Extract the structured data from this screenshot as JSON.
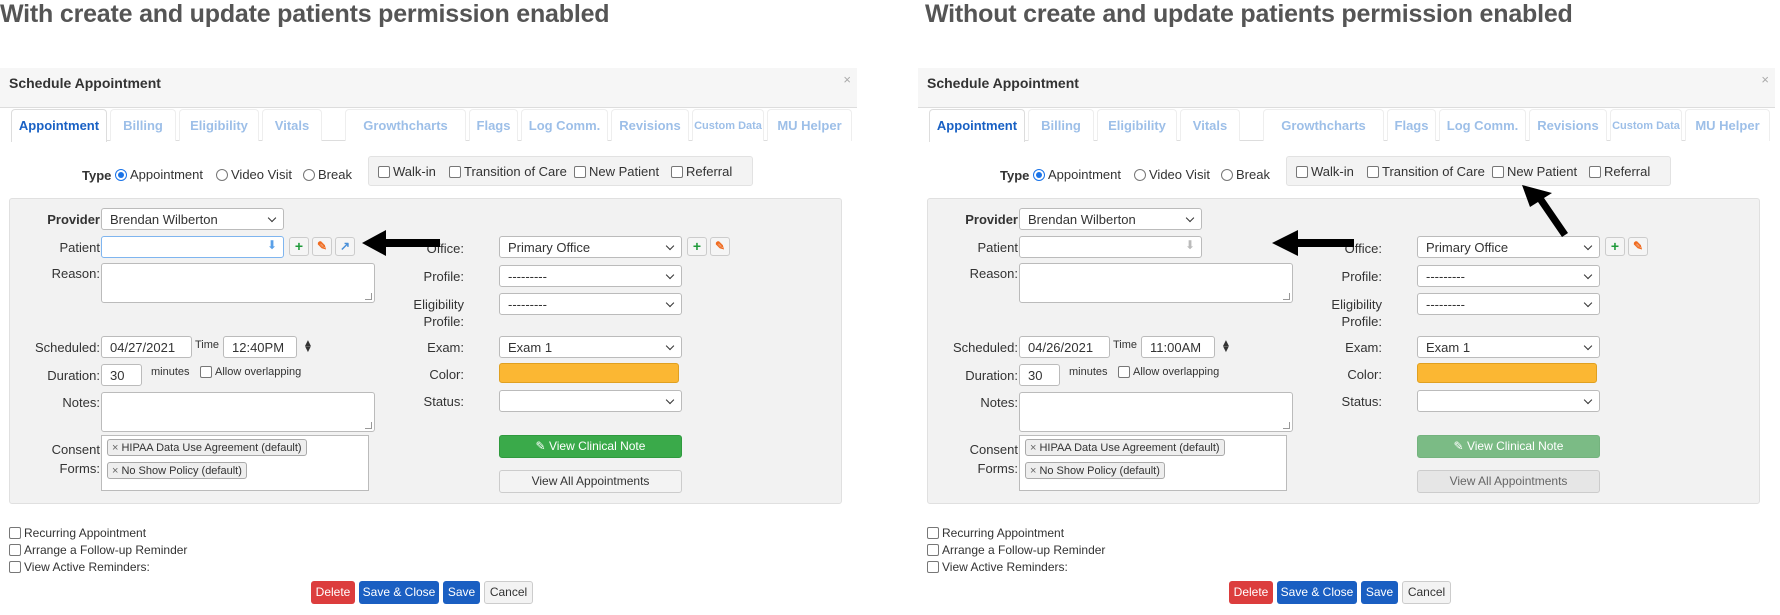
{
  "headings": {
    "left": "With create and update patients permission enabled",
    "right": "Without create and update patients permission enabled"
  },
  "panels": [
    {
      "modal_title": "Schedule Appointment",
      "close_icon": "×",
      "tabs": [
        "Appointment",
        "Billing",
        "Eligibility",
        "Vitals",
        "Growthcharts",
        "Flags",
        "Log Comm.",
        "Revisions",
        "Custom Data",
        "MU Helper"
      ],
      "active_tab": "Appointment",
      "type_label": "Type",
      "type_options": [
        "Appointment",
        "Video Visit",
        "Break"
      ],
      "type_selected": "Appointment",
      "flags": [
        "Walk-in",
        "Transition of Care",
        "New Patient",
        "Referral"
      ],
      "provider_label": "Provider",
      "provider_value": "Brendan Wilberton",
      "patient_label": "Patient",
      "patient_value": "",
      "patient_editable": true,
      "reason_label": "Reason:",
      "scheduled_label": "Scheduled:",
      "scheduled_date": "04/27/2021",
      "time_label": "Time",
      "time_value": "12:40PM",
      "duration_label": "Duration:",
      "duration_value": "30",
      "minutes_label": "minutes",
      "allow_overlapping": "Allow overlapping",
      "notes_label": "Notes:",
      "consent_label_1": "Consent",
      "consent_label_2": "Forms:",
      "consent_forms": [
        "HIPAA Data Use Agreement (default)",
        "No Show Policy (default)"
      ],
      "office_label": "Office:",
      "office_value": "Primary Office",
      "profile_label": "Profile:",
      "profile_value": "---------",
      "elig_label_1": "Eligibility",
      "elig_label_2": "Profile:",
      "elig_value": "---------",
      "exam_label": "Exam:",
      "exam_value": "Exam 1",
      "color_label": "Color:",
      "color_value": "#fbb733",
      "status_label": "Status:",
      "status_value": "",
      "view_clinical_note": "View Clinical Note",
      "view_all_appointments": "View All Appointments",
      "bottom_checks": [
        "Recurring Appointment",
        "Arrange a Follow-up Reminder",
        "View Active Reminders:"
      ],
      "buttons": {
        "delete": "Delete",
        "save_close": "Save & Close",
        "save": "Save",
        "cancel": "Cancel"
      }
    },
    {
      "modal_title": "Schedule Appointment",
      "close_icon": "×",
      "tabs": [
        "Appointment",
        "Billing",
        "Eligibility",
        "Vitals",
        "Growthcharts",
        "Flags",
        "Log Comm.",
        "Revisions",
        "Custom Data",
        "MU Helper"
      ],
      "active_tab": "Appointment",
      "type_label": "Type",
      "type_options": [
        "Appointment",
        "Video Visit",
        "Break"
      ],
      "type_selected": "Appointment",
      "flags": [
        "Walk-in",
        "Transition of Care",
        "New Patient",
        "Referral"
      ],
      "provider_label": "Provider",
      "provider_value": "Brendan Wilberton",
      "patient_label": "Patient",
      "patient_value": "",
      "patient_editable": false,
      "reason_label": "Reason:",
      "scheduled_label": "Scheduled:",
      "scheduled_date": "04/26/2021",
      "time_label": "Time",
      "time_value": "11:00AM",
      "duration_label": "Duration:",
      "duration_value": "30",
      "minutes_label": "minutes",
      "allow_overlapping": "Allow overlapping",
      "notes_label": "Notes:",
      "consent_label_1": "Consent",
      "consent_label_2": "Forms:",
      "consent_forms": [
        "HIPAA Data Use Agreement (default)",
        "No Show Policy (default)"
      ],
      "office_label": "Office:",
      "office_value": "Primary Office",
      "profile_label": "Profile:",
      "profile_value": "---------",
      "elig_label_1": "Eligibility",
      "elig_label_2": "Profile:",
      "elig_value": "---------",
      "exam_label": "Exam:",
      "exam_value": "Exam 1",
      "color_label": "Color:",
      "color_value": "#fbb733",
      "status_label": "Status:",
      "status_value": "",
      "view_clinical_note": "View Clinical Note",
      "view_all_appointments": "View All Appointments",
      "bottom_checks": [
        "Recurring Appointment",
        "Arrange a Follow-up Reminder",
        "View Active Reminders:"
      ],
      "buttons": {
        "delete": "Delete",
        "save_close": "Save & Close",
        "save": "Save",
        "cancel": "Cancel"
      }
    }
  ]
}
